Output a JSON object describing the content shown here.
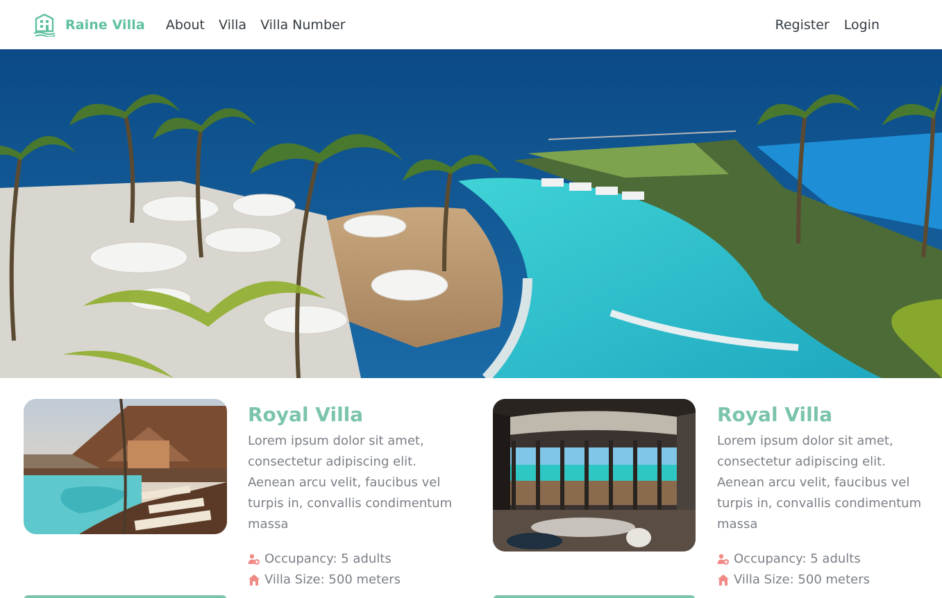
{
  "nav": {
    "brand": "Raine Villa",
    "links": [
      {
        "label": "About"
      },
      {
        "label": "Villa"
      },
      {
        "label": "Villa Number"
      }
    ],
    "auth": [
      {
        "label": "Register"
      },
      {
        "label": "Login"
      }
    ]
  },
  "colors": {
    "accent": "#5fc0a0",
    "title": "#7bc4ac",
    "meta_icon": "#f08a86"
  },
  "villas": [
    {
      "name": "Royal Villa",
      "description": "Lorem ipsum dolor sit amet, consectetur adipiscing elit. Aenean arcu velit, faucibus vel turpis in, convallis condimentum massa",
      "occupancy": "Occupancy: 5 adults",
      "size": "Villa Size: 500 meters",
      "photo_icon": "villa-poolside-photo"
    },
    {
      "name": "Royal Villa",
      "description": "Lorem ipsum dolor sit amet, consectetur adipiscing elit. Aenean arcu velit, faucibus vel turpis in, convallis condimentum massa",
      "occupancy": "Occupancy: 5 adults",
      "size": "Villa Size: 500 meters",
      "photo_icon": "villa-ocean-room-photo"
    }
  ],
  "icons": {
    "brand": "building-icon",
    "occupancy": "people-icon",
    "size": "house-icon"
  }
}
